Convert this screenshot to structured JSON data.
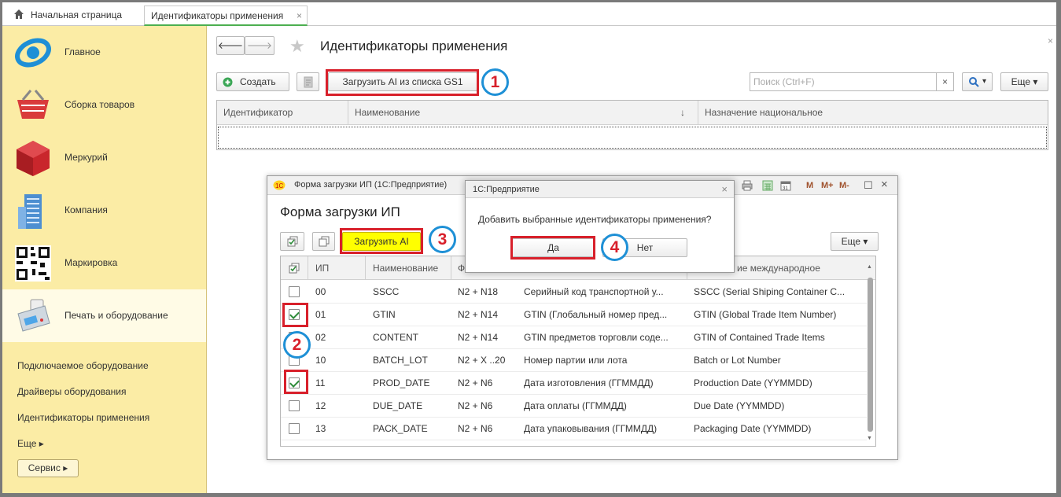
{
  "tabs": [
    {
      "label": "Начальная страница"
    },
    {
      "label": "Идентификаторы применения",
      "close": "×"
    }
  ],
  "sidebar": {
    "items": [
      {
        "label": "Главное"
      },
      {
        "label": "Сборка товаров"
      },
      {
        "label": "Меркурий"
      },
      {
        "label": "Компания"
      },
      {
        "label": "Маркировка"
      },
      {
        "label": "Печать и оборудование"
      }
    ],
    "links": [
      {
        "label": "Подключаемое оборудование"
      },
      {
        "label": "Драйверы оборудования"
      },
      {
        "label": "Идентификаторы применения"
      },
      {
        "label": "Еще ▸"
      }
    ],
    "service_label": "Сервис ▸"
  },
  "main": {
    "title": "Идентификаторы применения",
    "close": "×",
    "back": "🡐",
    "forward": "🡒",
    "create_label": "Создать",
    "load_gs1_label": "Загрузить AI из списка GS1",
    "search_placeholder": "Поиск (Ctrl+F)",
    "search_clear": "×",
    "search_btn": "▾",
    "more_label": "Еще ▾",
    "columns": [
      "Идентификатор",
      "Наименование",
      "↓",
      "Назначение национальное"
    ]
  },
  "form": {
    "window_title": "Форма загрузки ИП  (1С:Предприятие)",
    "heading": "Форма загрузки ИП",
    "load_ai_label": "Загрузить AI",
    "more_label": "Еще ▾",
    "toolbar_icons": {
      "m": "M",
      "mplus": "M+",
      "mminus": "M-",
      "maximize": "☐",
      "close": "×"
    },
    "columns": [
      "ИП",
      "Наименование",
      "Ф",
      "ие международное"
    ],
    "rows": [
      {
        "checked": false,
        "ip": "00",
        "name": "SSCC",
        "format": "N2 + N18",
        "nat": "Серийный код транспортной у...",
        "intl": "SSCC (Serial Shiping Container C..."
      },
      {
        "checked": true,
        "ip": "01",
        "name": "GTIN",
        "format": "N2 + N14",
        "nat": "GTIN (Глобальный номер пред...",
        "intl": "GTIN (Global Trade Item Number)"
      },
      {
        "checked": false,
        "ip": "02",
        "name": "CONTENT",
        "format": "N2 + N14",
        "nat": "GTIN предметов торговли соде...",
        "intl": "GTIN of Contained Trade Items"
      },
      {
        "checked": false,
        "ip": "10",
        "name": "BATCH_LOT",
        "format": "N2 + X ..20",
        "nat": "Номер партии или лота",
        "intl": "Batch or Lot Number"
      },
      {
        "checked": true,
        "ip": "11",
        "name": "PROD_DATE",
        "format": "N2 + N6",
        "nat": "Дата изготовления (ГГММДД)",
        "intl": "Production Date (YYMMDD)"
      },
      {
        "checked": false,
        "ip": "12",
        "name": "DUE_DATE",
        "format": "N2 + N6",
        "nat": "Дата оплаты (ГГММДД)",
        "intl": "Due Date (YYMMDD)"
      },
      {
        "checked": false,
        "ip": "13",
        "name": "PACK_DATE",
        "format": "N2 + N6",
        "nat": "Дата упаковывания (ГГММДД)",
        "intl": "Packaging Date (YYMMDD)"
      }
    ]
  },
  "confirm": {
    "title": "1С:Предприятие",
    "close": "×",
    "message": "Добавить выбранные идентификаторы применения?",
    "yes_label": "Да",
    "no_label": "Нет"
  },
  "annotations": [
    "1",
    "2",
    "3",
    "4"
  ],
  "colors": {
    "sidebar": "#fbeca5",
    "accent_red": "#d8202b",
    "accent_blue": "#1e90d6",
    "load_ai_bg": "#ffff00"
  }
}
